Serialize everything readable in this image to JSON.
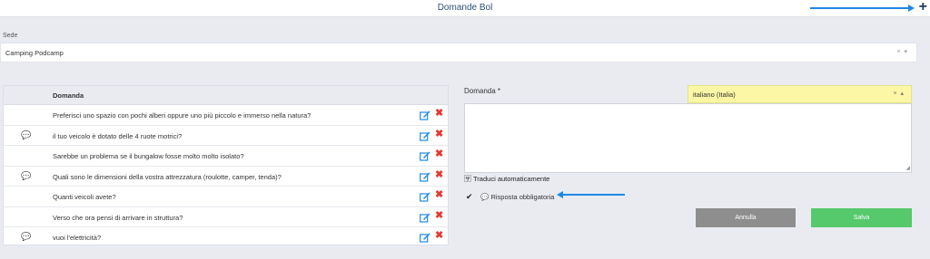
{
  "header": {
    "title": "Domande Bol",
    "add_icon": "plus-icon"
  },
  "sede": {
    "label": "Sede",
    "value": "Camping Podcamp",
    "clear_icon": "×",
    "dropdown_icon": "▾"
  },
  "table": {
    "column_header": "Domanda",
    "rows": [
      {
        "text": "Preferisci uno spazio con pochi alberi oppure uno più piccolo e immerso nella natura?",
        "has_bubble": false
      },
      {
        "text": "il tuo veicolo è dotato delle 4 ruote motrici?",
        "has_bubble": true
      },
      {
        "text": "Sarebbe un problema se il bungalow fosse molto molto isolato?",
        "has_bubble": false
      },
      {
        "text": "Quali sono le dimensioni della vostra attrezzatura (roulotte, camper, tenda)?",
        "has_bubble": true
      },
      {
        "text": "Quanti veicoli avete?",
        "has_bubble": false
      },
      {
        "text": "Verso che ora pensi di arrivare in struttura?",
        "has_bubble": false
      },
      {
        "text": "vuoi l'elettricità?",
        "has_bubble": true
      }
    ],
    "icons": {
      "bubble": "speech-bubble-icon",
      "edit": "edit-icon",
      "delete": "delete-icon"
    },
    "colors": {
      "edit": "#1e88e5",
      "delete": "#e53935"
    }
  },
  "form": {
    "domanda_label": "Domanda *",
    "language": {
      "value": "italiano (Italia)",
      "clear_icon": "×",
      "dropdown_icon": "▴",
      "color": "#fbf7a4"
    },
    "textarea_value": "",
    "traduci_label": "Traduci automaticamente",
    "checkbox_mark": "✔",
    "risposta_label": "Risposta obbligatoria",
    "buttons": {
      "cancel": "Annulla",
      "save": "Salva"
    },
    "colors": {
      "cancel": "#8e8e8e",
      "save": "#55c96b",
      "annotation_arrow": "#1e88e5"
    }
  }
}
